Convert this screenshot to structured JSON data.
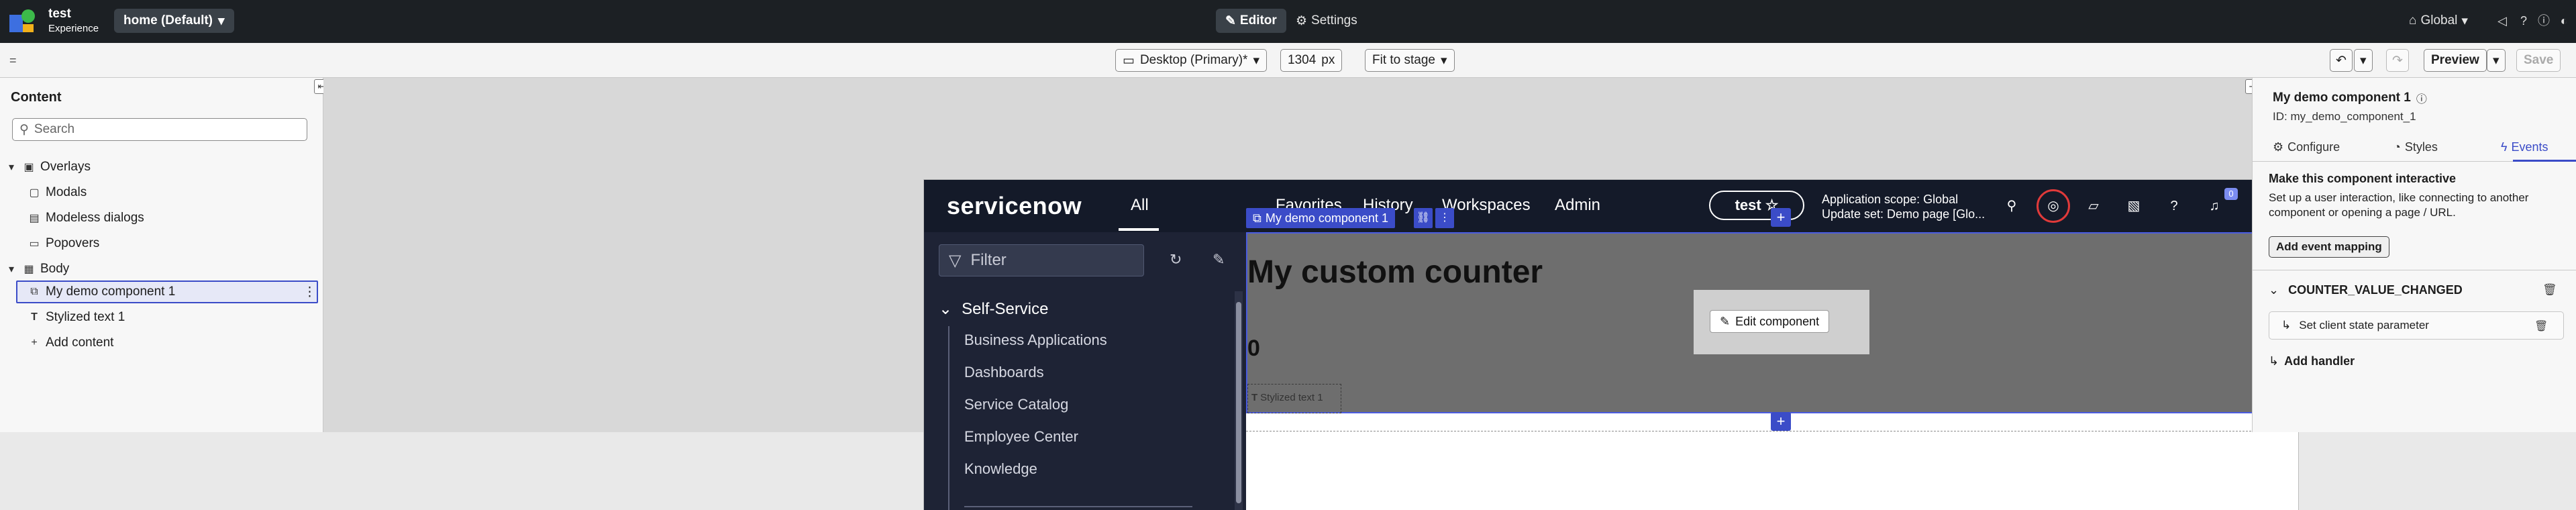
{
  "app": {
    "title": "test",
    "subtitle": "Experience",
    "page_select": "home (Default)",
    "editor_tab": "Editor",
    "settings_tab": "Settings",
    "scope_select": "Global"
  },
  "toolbar": {
    "device": "Desktop (Primary)*",
    "width": "1304",
    "width_unit": "px",
    "zoom": "Fit to stage",
    "preview": "Preview",
    "save": "Save"
  },
  "left_panel": {
    "title": "Content",
    "search_placeholder": "Search",
    "tree": [
      {
        "label": "Overlays",
        "icon": "overlay-icon"
      },
      {
        "label": "Modals",
        "icon": "modal-icon"
      },
      {
        "label": "Modeless dialogs",
        "icon": "dialog-icon"
      },
      {
        "label": "Popovers",
        "icon": "popover-icon"
      },
      {
        "label": "Body",
        "icon": "layout-icon"
      },
      {
        "label": "My demo component 1",
        "icon": "component-icon"
      },
      {
        "label": "Stylized text 1",
        "icon": "text-icon"
      },
      {
        "label": "Add content",
        "icon": "plus-icon"
      }
    ]
  },
  "stage": {
    "logo": "servicenow",
    "all_tab": "All",
    "nav": [
      "Favorites",
      "History",
      "Workspaces",
      "Admin"
    ],
    "scope_pill": "test",
    "scope_line1": "Application scope: Global",
    "scope_line2": "Update set: Demo page [Glo...",
    "notifications_count": "0",
    "filter_placeholder": "Filter",
    "menu_section": "Self-Service",
    "menu_links": [
      "Business Applications",
      "Dashboards",
      "Service Catalog",
      "Employee Center",
      "Knowledge"
    ],
    "component_label": "My demo component 1",
    "component_title": "My custom counter",
    "component_count": "0",
    "edit_button": "Edit component",
    "stylized_label": "Stylized text 1"
  },
  "right_panel": {
    "title": "My demo component 1",
    "id_text": "ID: my_demo_component_1",
    "tabs": [
      "Configure",
      "Styles",
      "Events"
    ],
    "active_tab": "Events",
    "heading": "Make this component interactive",
    "description": "Set up a user interaction, like connecting to another component or opening a page / URL.",
    "add_event_button": "Add event mapping",
    "event_name": "COUNTER_VALUE_CHANGED",
    "handler": "Set client state parameter",
    "add_handler": "Add handler"
  },
  "colors": {
    "accent": "#3b4cc8",
    "topbar": "#1c2024",
    "sn_header": "#141a29",
    "highlight_ring": "#e03a3a"
  }
}
